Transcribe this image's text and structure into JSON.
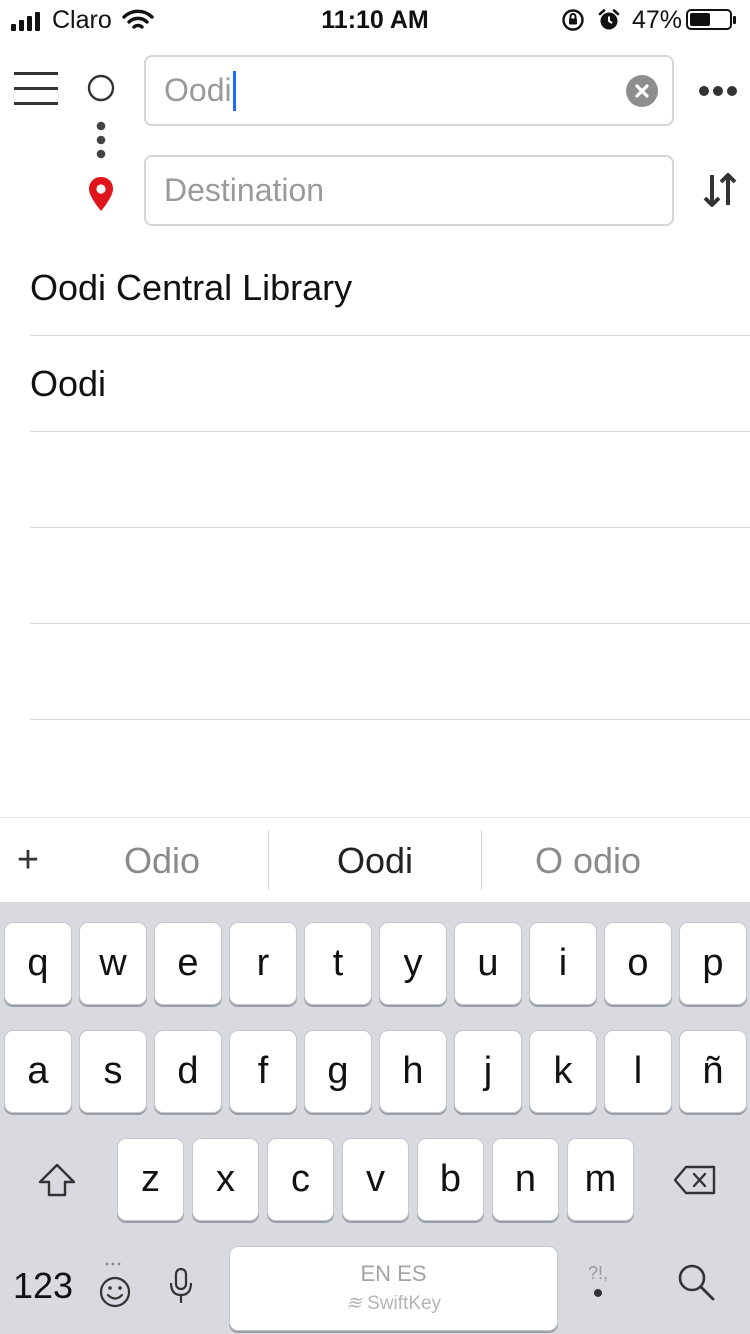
{
  "status": {
    "carrier": "Claro",
    "time": "11:10 AM",
    "battery_pct": "47%"
  },
  "search": {
    "origin_value": "Oodi",
    "destination_placeholder": "Destination"
  },
  "results": [
    {
      "label": "Oodi Central Library"
    },
    {
      "label": "Oodi"
    },
    {
      "label": ""
    },
    {
      "label": ""
    },
    {
      "label": ""
    }
  ],
  "suggestions": {
    "plus": "+",
    "items": [
      "Odio",
      "Oodi",
      "O odio"
    ]
  },
  "keyboard": {
    "row1": [
      "q",
      "w",
      "e",
      "r",
      "t",
      "y",
      "u",
      "i",
      "o",
      "p"
    ],
    "row2": [
      "a",
      "s",
      "d",
      "f",
      "g",
      "h",
      "j",
      "k",
      "l",
      "ñ"
    ],
    "row3": [
      "z",
      "x",
      "c",
      "v",
      "b",
      "n",
      "m"
    ],
    "numbers_label": "123",
    "languages": "EN ES",
    "brand": "SwiftKey",
    "punct": "?!,"
  },
  "colors": {
    "accent": "#1a6dff",
    "pin": "#e0141b",
    "keyboard_bg": "#d8dadf"
  },
  "icons": {
    "menu": "hamburger-icon",
    "origin": "circle-icon",
    "destination": "location-pin-icon",
    "more": "more-dots-icon",
    "swap": "swap-vertical-icon",
    "clear": "clear-icon"
  }
}
